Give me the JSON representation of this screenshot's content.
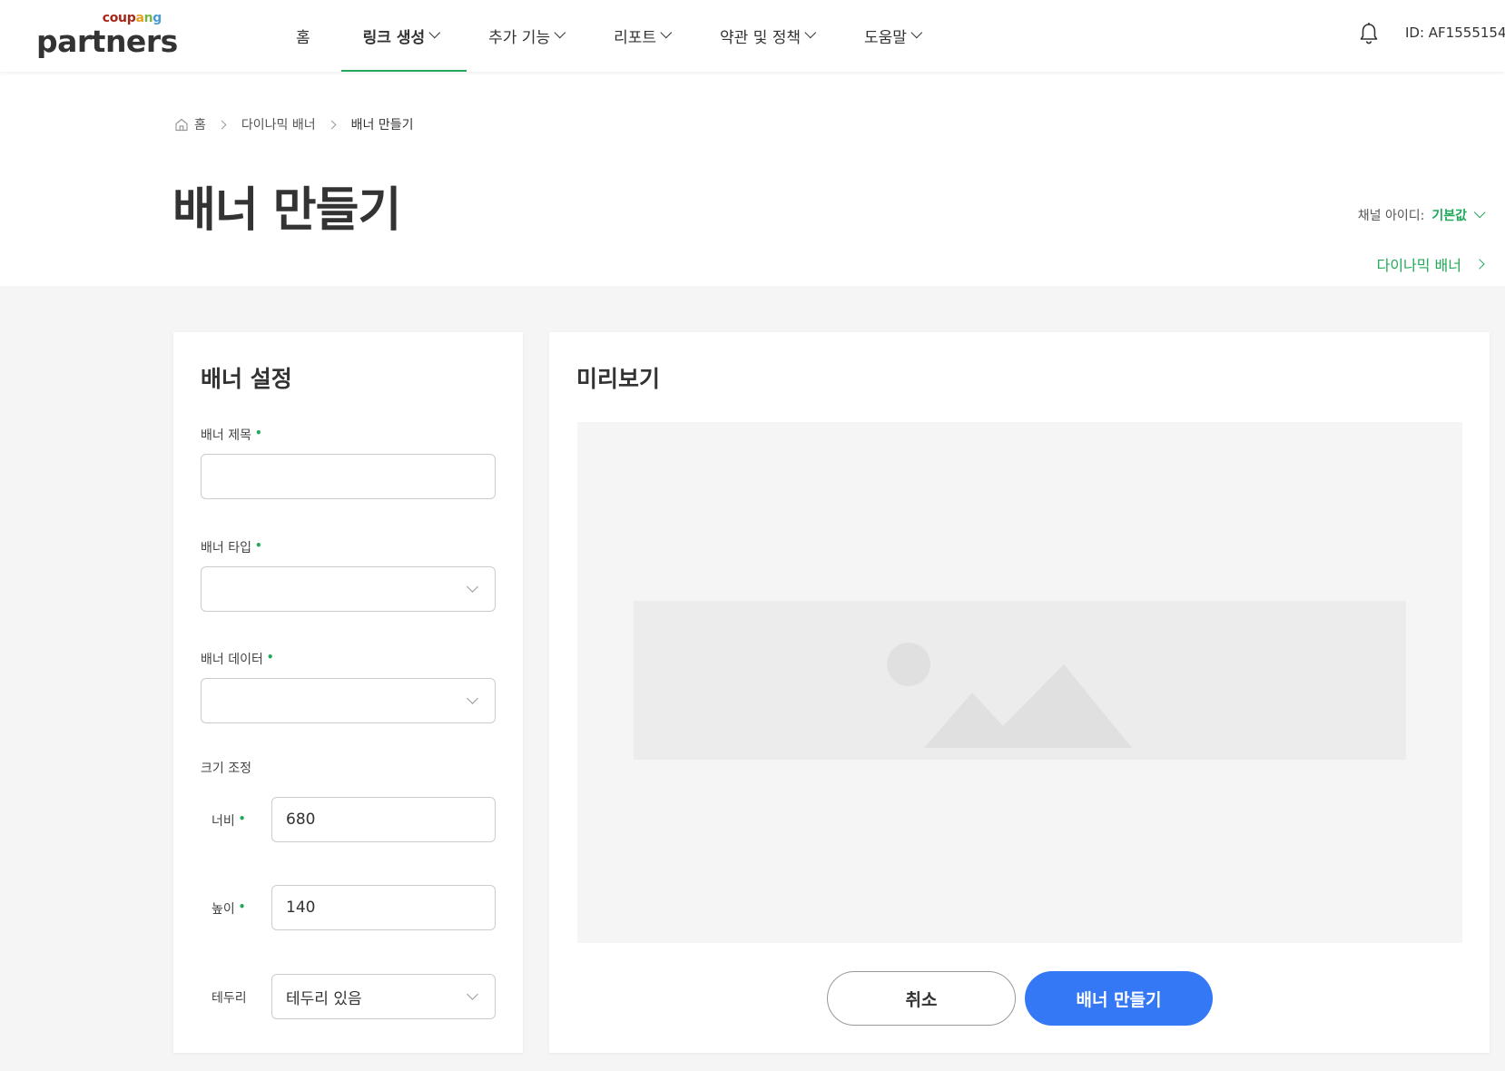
{
  "brand": {
    "coupang_letters": [
      {
        "ch": "c",
        "color": "#a5281b"
      },
      {
        "ch": "o",
        "color": "#a5281b"
      },
      {
        "ch": "u",
        "color": "#a5281b"
      },
      {
        "ch": "p",
        "color": "#a5281b"
      },
      {
        "ch": "a",
        "color": "#e8a023"
      },
      {
        "ch": "n",
        "color": "#76b843"
      },
      {
        "ch": "g",
        "color": "#4a9bd6"
      }
    ],
    "coupang_c": "c",
    "coupang_o": "o",
    "coupang_u": "u",
    "coupang_p": "p",
    "coupang_a": "a",
    "coupang_n": "n",
    "coupang_g": "g",
    "partners": "partners"
  },
  "nav": {
    "items": [
      {
        "label": "홈",
        "has_dropdown": false,
        "active": false
      },
      {
        "label": "링크 생성",
        "has_dropdown": true,
        "active": true
      },
      {
        "label": "추가 기능",
        "has_dropdown": true,
        "active": false
      },
      {
        "label": "리포트",
        "has_dropdown": true,
        "active": false
      },
      {
        "label": "약관 및 정책",
        "has_dropdown": true,
        "active": false
      },
      {
        "label": "도움말",
        "has_dropdown": true,
        "active": false
      }
    ],
    "user_id": "ID: AF1555154",
    "accent_color": "#22a85a"
  },
  "breadcrumb": {
    "home": "홈",
    "parent": "다이나믹 배너",
    "current": "배너 만들기"
  },
  "page": {
    "title": "배너 만들기",
    "channel_label": "채널 아이디:",
    "channel_value": "기본값",
    "dynamic_link": "다이나믹 배너"
  },
  "settings": {
    "title": "배너 설정",
    "banner_title_label": "배너 제목",
    "banner_title_value": "",
    "banner_type_label": "배너 타입",
    "banner_type_value": "",
    "banner_data_label": "배너 데이터",
    "banner_data_value": "",
    "size_label": "크기 조정",
    "width_label": "너비",
    "width_value": "680",
    "height_label": "높이",
    "height_value": "140",
    "border_label": "테두리",
    "border_value": "테두리 있음",
    "required_mark": "•"
  },
  "preview": {
    "title": "미리보기",
    "cancel_label": "취소",
    "create_label": "배너 만들기",
    "primary_color": "#3478f6"
  }
}
